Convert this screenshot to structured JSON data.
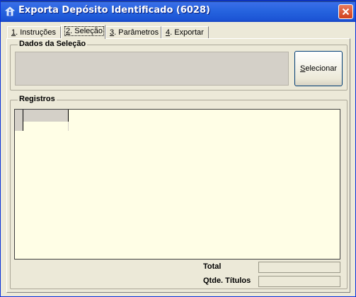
{
  "window": {
    "title": "Exporta Depósito Identificado (6028)",
    "title_color": "#ffffff",
    "titlebar_color": "#2563de",
    "close_icon": "close-icon",
    "app_icon": "app-icon"
  },
  "tabs": [
    {
      "key": "1",
      "rest": ". Instruções",
      "active": false
    },
    {
      "key": "2",
      "rest": ". Seleção",
      "active": true
    },
    {
      "key": "3",
      "rest": ". Parâmetros",
      "active": false
    },
    {
      "key": "4",
      "rest": ". Exportar",
      "active": false
    }
  ],
  "selection_group": {
    "title": "Dados da Seleção",
    "field_value": "",
    "button_key": "S",
    "button_rest": "elecionar"
  },
  "records_group": {
    "title": "Registros",
    "grid_background": "#fffee6"
  },
  "summary": {
    "total_label": "Total",
    "total_value": "",
    "count_label": "Qtde. Títulos",
    "count_value": ""
  }
}
